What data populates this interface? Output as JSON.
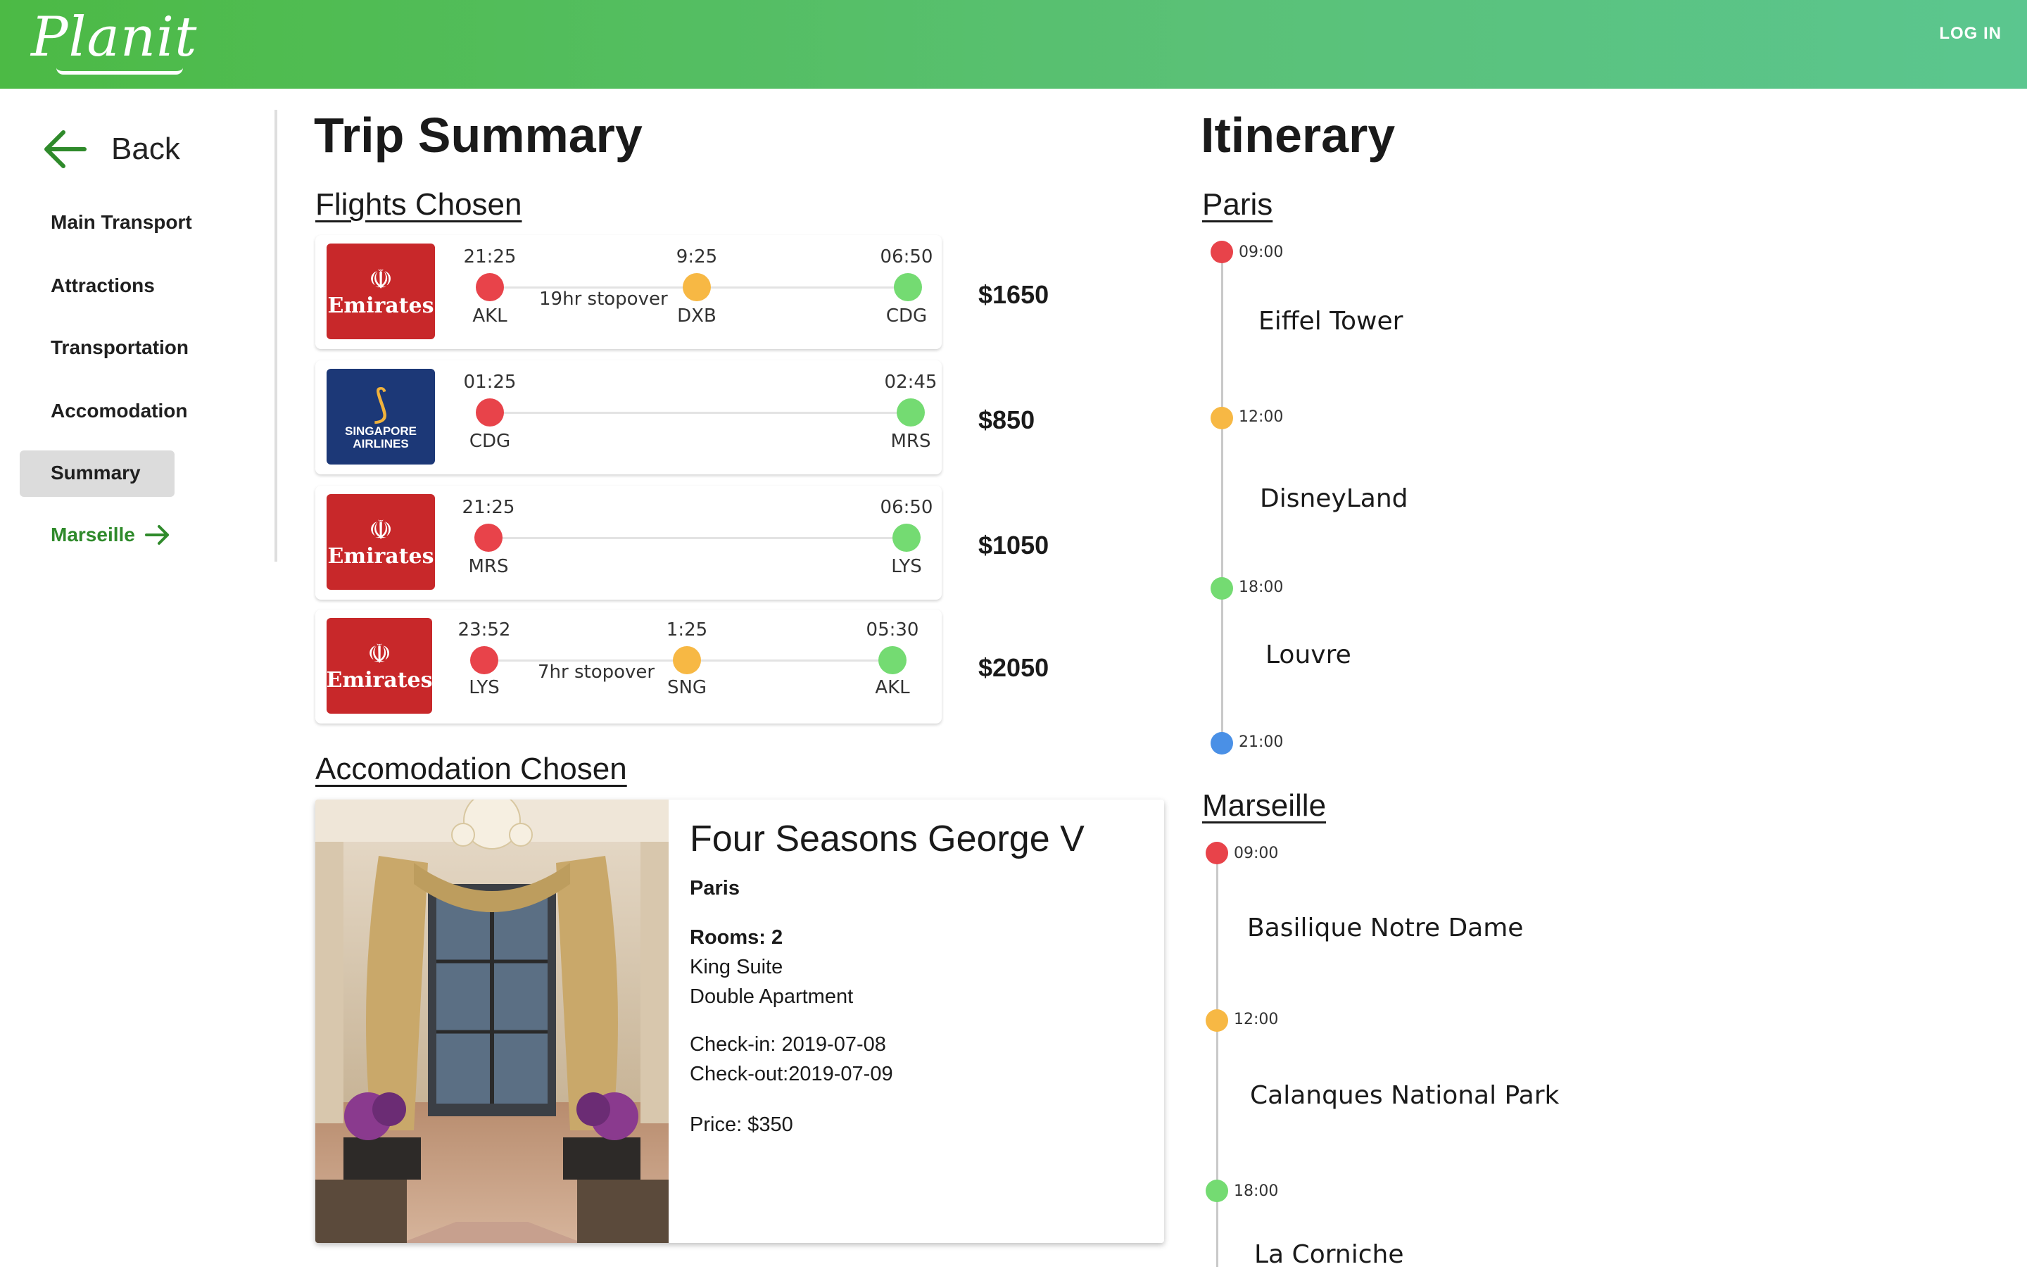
{
  "header": {
    "logo": "Planit",
    "login": "LOG IN",
    "gradient_start": "#4cba45",
    "gradient_end": "#5bc68f"
  },
  "sidebar": {
    "back": "Back",
    "items": [
      {
        "label": "Main Transport"
      },
      {
        "label": "Attractions"
      },
      {
        "label": "Transportation"
      },
      {
        "label": "Accomodation"
      },
      {
        "label": "Summary",
        "active": true
      }
    ],
    "next": "Marseille"
  },
  "summary": {
    "title": "Trip Summary",
    "flights_heading": "Flights Chosen",
    "flights": [
      {
        "airline": "Emirates",
        "dep_time": "21:25",
        "dep_code": "AKL",
        "stop_time": "9:25",
        "stop_code": "DXB",
        "stopover": "19hr stopover",
        "arr_time": "06:50",
        "arr_code": "CDG",
        "price": "$1650"
      },
      {
        "airline": "Singapore Airlines",
        "brand": "SINGAPORE",
        "brand2": "AIRLINES",
        "dep_time": "01:25",
        "dep_code": "CDG",
        "arr_time": "02:45",
        "arr_code": "MRS",
        "price": "$850"
      },
      {
        "airline": "Emirates",
        "dep_time": "21:25",
        "dep_code": "MRS",
        "arr_time": "06:50",
        "arr_code": "LYS",
        "price": "$1050"
      },
      {
        "airline": "Emirates",
        "dep_time": "23:52",
        "dep_code": "LYS",
        "stop_time": "1:25",
        "stop_code": "SNG",
        "stopover": "7hr stopover",
        "arr_time": "05:30",
        "arr_code": "AKL",
        "price": "$2050"
      }
    ],
    "accommodation_heading": "Accomodation Chosen",
    "accommodation": {
      "name": "Four Seasons George V",
      "city": "Paris",
      "rooms": "Rooms: 2",
      "room_types": [
        "King Suite",
        "Double Apartment"
      ],
      "checkin": "Check-in: 2019-07-08",
      "checkout": "Check-out:2019-07-09",
      "price": "Price: $350"
    }
  },
  "itinerary": {
    "title": "Itinerary",
    "cities": [
      {
        "name": "Paris",
        "stops": [
          {
            "time": "09:00",
            "place": "Eiffel Tower",
            "color": "#e8434a"
          },
          {
            "time": "12:00",
            "place": "DisneyLand",
            "color": "#f7b844"
          },
          {
            "time": "18:00",
            "place": "Louvre",
            "color": "#74db72"
          },
          {
            "time": "21:00",
            "place": "",
            "color": "#4a90e6"
          }
        ]
      },
      {
        "name": "Marseille",
        "stops": [
          {
            "time": "09:00",
            "place": "Basilique Notre Dame",
            "color": "#e8434a"
          },
          {
            "time": "12:00",
            "place": "Calanques National Park",
            "color": "#f7b844"
          },
          {
            "time": "18:00",
            "place": "La Corniche",
            "color": "#74db72"
          }
        ]
      }
    ]
  },
  "icons": [
    "arrow-left-icon",
    "arrow-right-icon",
    "emirates-logo",
    "singapore-airlines-logo"
  ]
}
